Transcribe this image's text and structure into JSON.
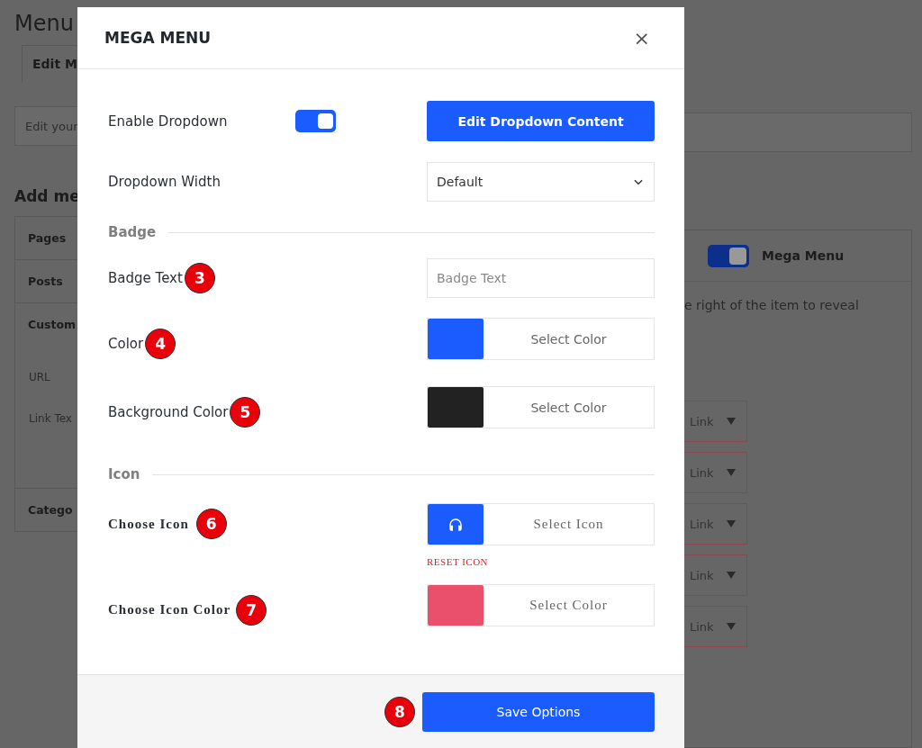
{
  "background": {
    "page_title": "Menu",
    "tab": "Edit M",
    "notice": "Edit your",
    "section_title": "Add me",
    "accordion": [
      {
        "label": "Pages",
        "expanded": false
      },
      {
        "label": "Posts",
        "expanded": false
      },
      {
        "label": "Custom",
        "expanded": true,
        "fields": [
          "URL",
          "Link Tex"
        ]
      },
      {
        "label": "Catego",
        "expanded": false
      }
    ],
    "item_toggle": {
      "on": true,
      "label": "Mega Menu"
    },
    "hint": "e right of the item to reveal",
    "link_items": [
      {
        "label": "Link"
      },
      {
        "label": "Link"
      },
      {
        "label": "Link"
      },
      {
        "label": "Link"
      },
      {
        "label": "Link"
      }
    ]
  },
  "modal": {
    "title": "MEGA MENU",
    "close": "×",
    "rows": [
      {
        "kind": "toggle",
        "label": "Enable Dropdown",
        "on": true,
        "button": "Edit Dropdown Content"
      },
      {
        "kind": "select",
        "label": "Dropdown Width",
        "value": "Default"
      },
      {
        "kind": "section",
        "label": "Badge"
      },
      {
        "kind": "text",
        "label": "Badge Text",
        "placeholder": "Badge Text",
        "marker": "3"
      },
      {
        "kind": "color",
        "label": "Color",
        "color": "#1a5cff",
        "button": "Select Color",
        "marker": "4"
      },
      {
        "kind": "color",
        "label": "Background Color",
        "color": "#222222",
        "button": "Select Color",
        "marker": "5"
      },
      {
        "kind": "section",
        "label": "Icon"
      },
      {
        "kind": "icon",
        "label": "Choose Icon",
        "button": "Select Icon",
        "reset": "RESET ICON",
        "marker": "6"
      },
      {
        "kind": "icon_color",
        "label": "Choose Icon Color",
        "color": "#ea4f6c",
        "button": "Select Color",
        "marker": "7"
      }
    ],
    "footer": {
      "marker": "8",
      "button": "Save Options"
    }
  }
}
